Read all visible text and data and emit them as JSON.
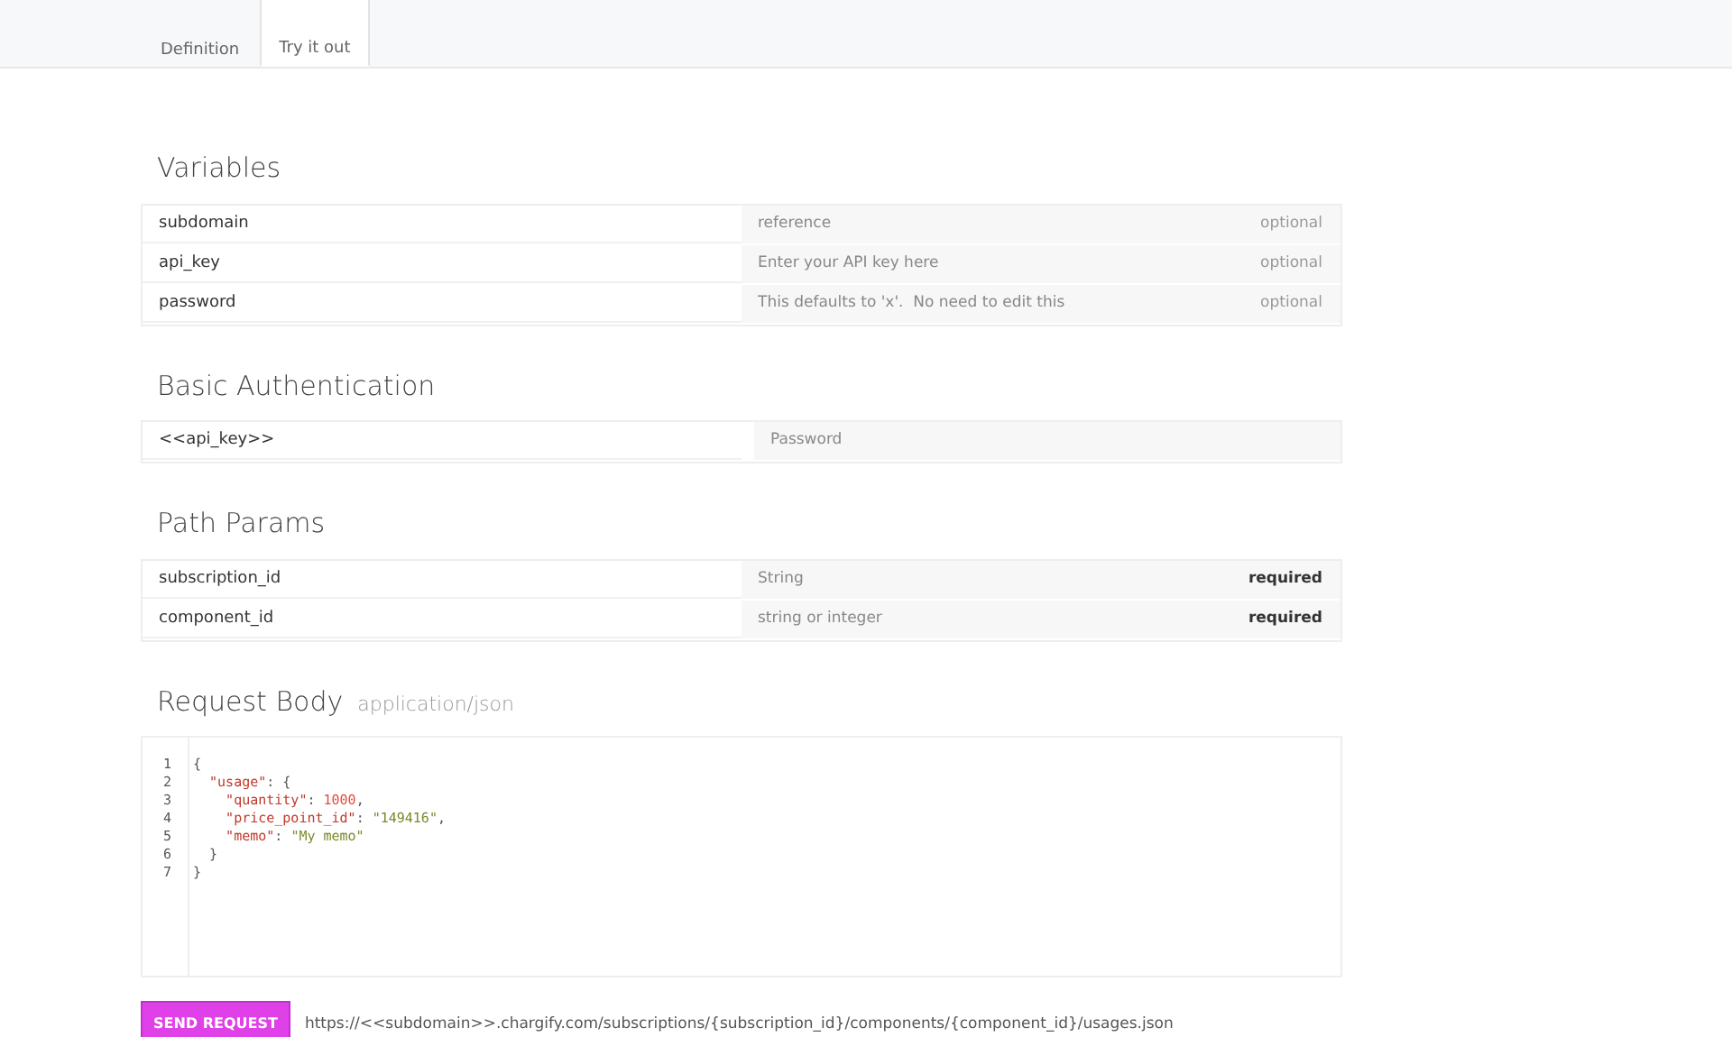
{
  "tabs": [
    {
      "label": "Definition",
      "selected": false
    },
    {
      "label": "Try it out",
      "selected": true
    }
  ],
  "variables": {
    "title": "Variables",
    "rows": [
      {
        "name": "subdomain",
        "placeholder": "reference",
        "note": "optional",
        "required": false
      },
      {
        "name": "api_key",
        "placeholder": "Enter your API key here",
        "note": "optional",
        "required": false
      },
      {
        "name": "password",
        "placeholder": "This defaults to 'x'.  No need to edit this",
        "note": "optional",
        "required": false
      }
    ]
  },
  "basic_auth": {
    "title": "Basic Authentication",
    "rows": [
      {
        "name": "<<api_key>>",
        "placeholder": "Password"
      }
    ]
  },
  "path_params": {
    "title": "Path Params",
    "rows": [
      {
        "name": "subscription_id",
        "placeholder": "String",
        "note": "required",
        "required": true
      },
      {
        "name": "component_id",
        "placeholder": "string or integer",
        "note": "required",
        "required": true
      }
    ]
  },
  "request_body": {
    "title": "Request Body",
    "content_type": "application/json",
    "lines": [
      {
        "number": "1",
        "tokens": [
          {
            "kind": "punct",
            "text": "{"
          }
        ]
      },
      {
        "number": "2",
        "tokens": [
          {
            "kind": "key",
            "text": "  \"usage\""
          },
          {
            "kind": "punct",
            "text": ": {"
          }
        ]
      },
      {
        "number": "3",
        "tokens": [
          {
            "kind": "key",
            "text": "    \"quantity\""
          },
          {
            "kind": "punct",
            "text": ": "
          },
          {
            "kind": "number",
            "text": "1000"
          },
          {
            "kind": "punct",
            "text": ","
          }
        ]
      },
      {
        "number": "4",
        "tokens": [
          {
            "kind": "key",
            "text": "    \"price_point_id\""
          },
          {
            "kind": "punct",
            "text": ": "
          },
          {
            "kind": "string",
            "text": "\"149416\""
          },
          {
            "kind": "punct",
            "text": ","
          }
        ]
      },
      {
        "number": "5",
        "tokens": [
          {
            "kind": "key",
            "text": "    \"memo\""
          },
          {
            "kind": "punct",
            "text": ": "
          },
          {
            "kind": "string",
            "text": "\"My memo\""
          }
        ]
      },
      {
        "number": "6",
        "tokens": [
          {
            "kind": "punct",
            "text": "  }"
          }
        ]
      },
      {
        "number": "7",
        "tokens": [
          {
            "kind": "punct",
            "text": "}"
          }
        ]
      }
    ]
  },
  "send_button": "SEND REQUEST",
  "url": "https://<<subdomain>>.chargify.com/subscriptions/{subscription_id}/components/{component_id}/usages.json"
}
